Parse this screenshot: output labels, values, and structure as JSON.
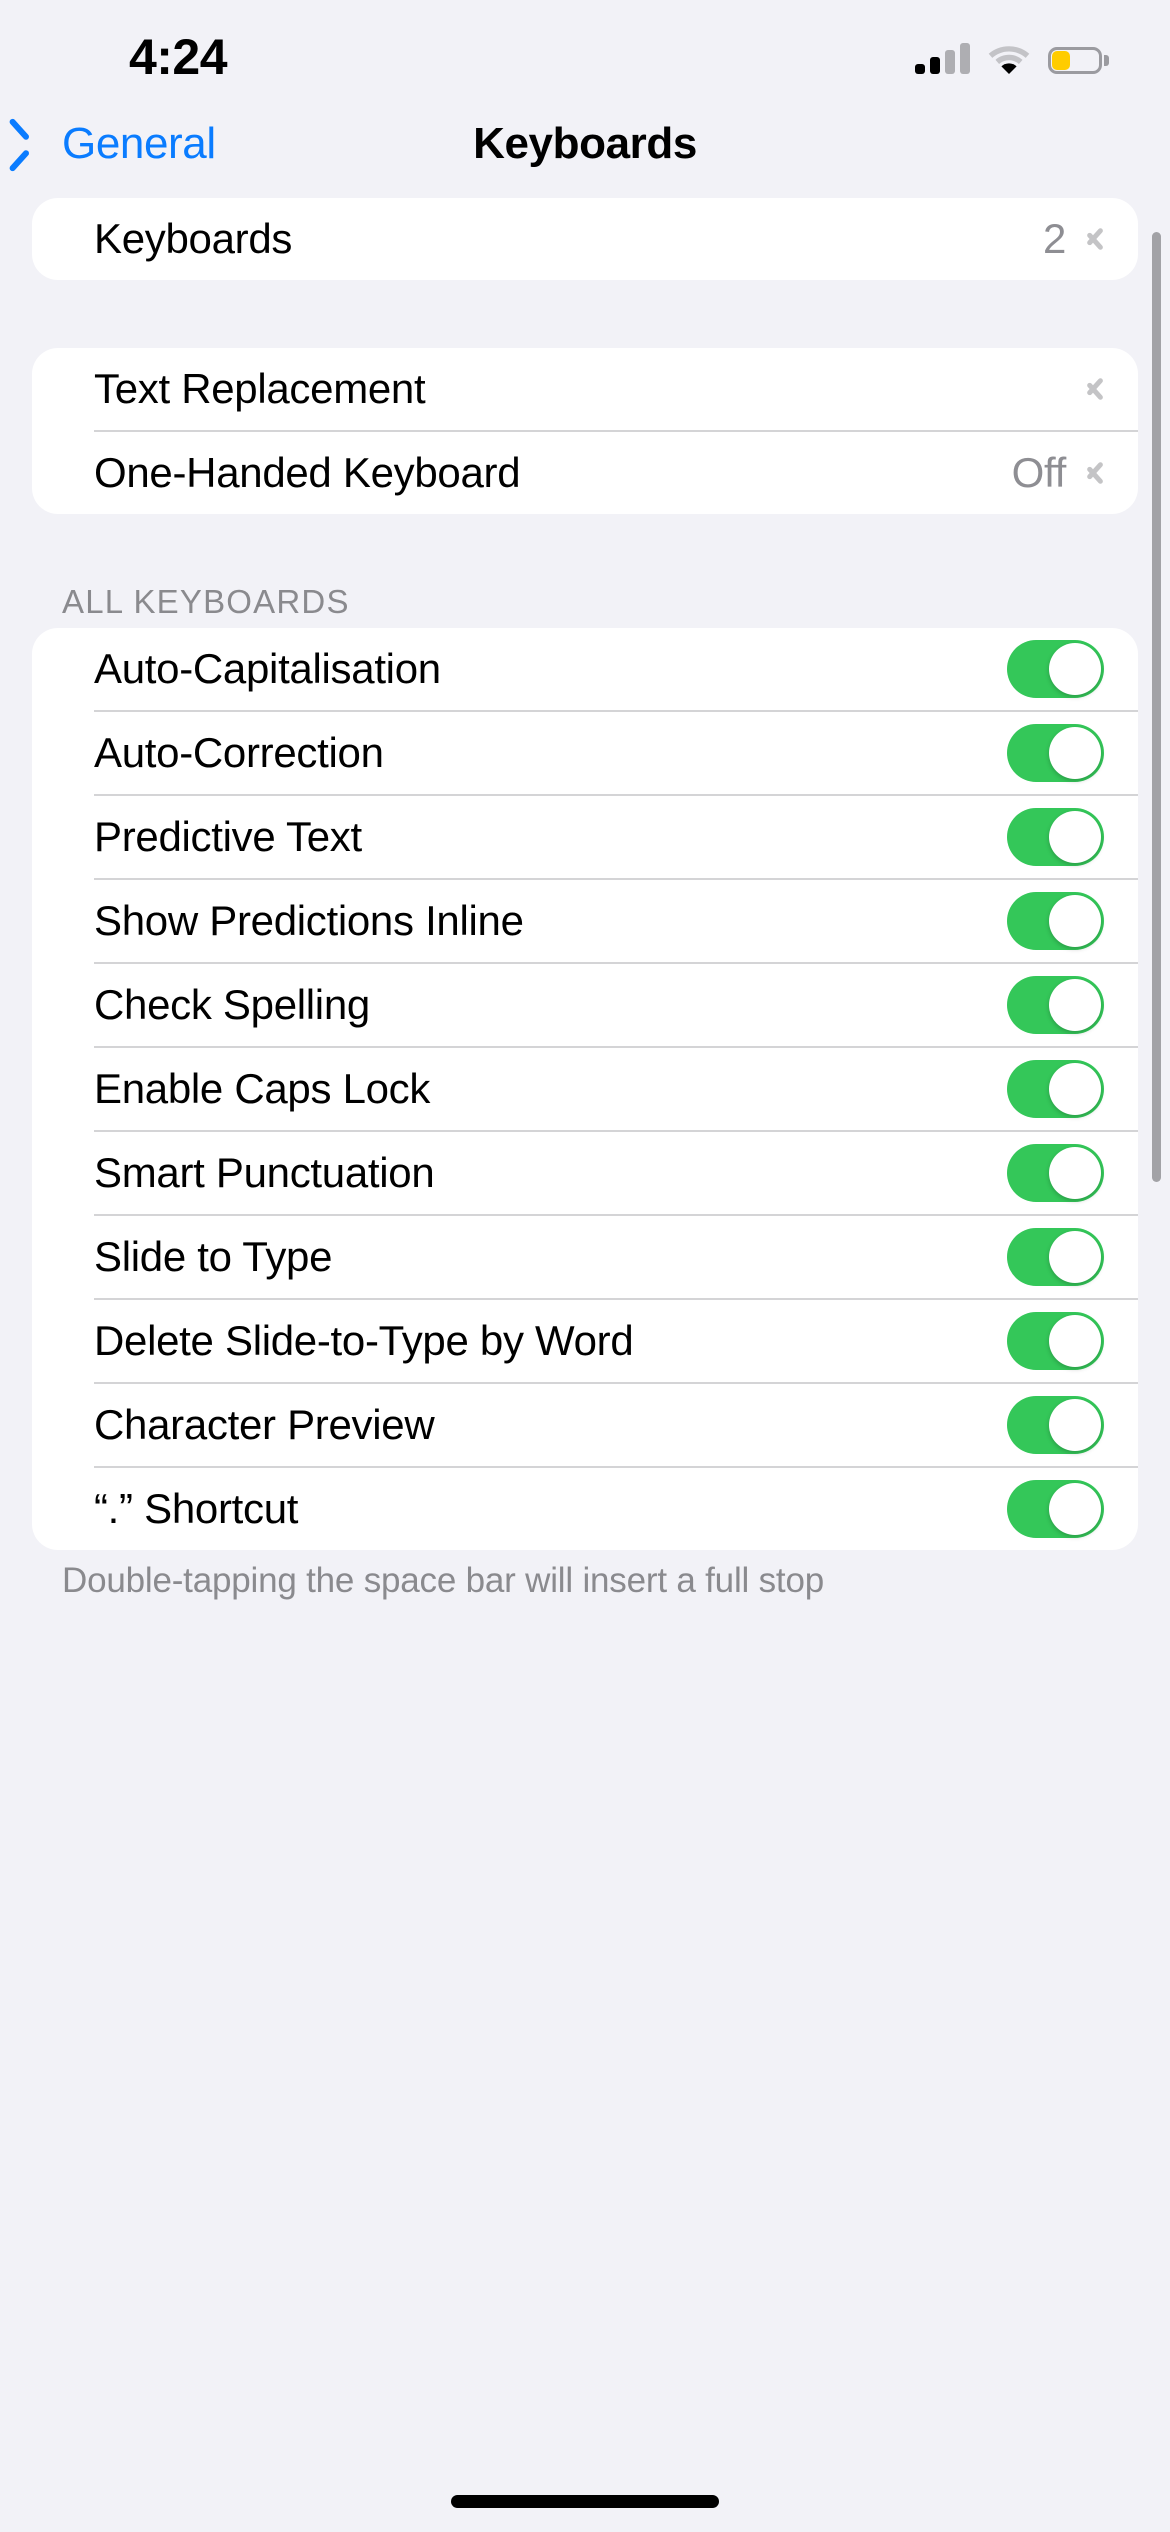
{
  "status_bar": {
    "time": "4:24",
    "cellular_icon": "cellular-signal-icon",
    "cellular_bars_active": 2,
    "cellular_bars_total": 4,
    "wifi_icon": "wifi-icon",
    "battery_icon": "battery-icon",
    "battery_color": "#FFCC00"
  },
  "nav": {
    "back_label": "General",
    "back_icon": "chevron-left-icon",
    "title": "Keyboards"
  },
  "section1": {
    "rows": [
      {
        "label": "Keyboards",
        "value": "2",
        "accessory": "chevron-right-icon"
      }
    ]
  },
  "section2": {
    "rows": [
      {
        "label": "Text Replacement",
        "value": "",
        "accessory": "chevron-right-icon"
      },
      {
        "label": "One-Handed Keyboard",
        "value": "Off",
        "accessory": "chevron-right-icon"
      }
    ]
  },
  "section3": {
    "header": "ALL KEYBOARDS",
    "rows": [
      {
        "label": "Auto-Capitalisation",
        "state": "on"
      },
      {
        "label": "Auto-Correction",
        "state": "on"
      },
      {
        "label": "Predictive Text",
        "state": "on"
      },
      {
        "label": "Show Predictions Inline",
        "state": "on"
      },
      {
        "label": "Check Spelling",
        "state": "on"
      },
      {
        "label": "Enable Caps Lock",
        "state": "on"
      },
      {
        "label": "Smart Punctuation",
        "state": "on"
      },
      {
        "label": "Slide to Type",
        "state": "on"
      },
      {
        "label": "Delete Slide-to-Type by Word",
        "state": "on"
      },
      {
        "label": "Character Preview",
        "state": "on"
      },
      {
        "label": "“.” Shortcut",
        "state": "on"
      }
    ],
    "footer": "Double-tapping the space bar will insert a full stop"
  },
  "colors": {
    "page_background": "#F2F2F7",
    "card_background": "#FFFFFF",
    "accent_blue": "#0A7CFF",
    "toggle_on_green": "#34C759",
    "secondary_text": "#8E8E93",
    "separator": "#C6C6C8"
  }
}
